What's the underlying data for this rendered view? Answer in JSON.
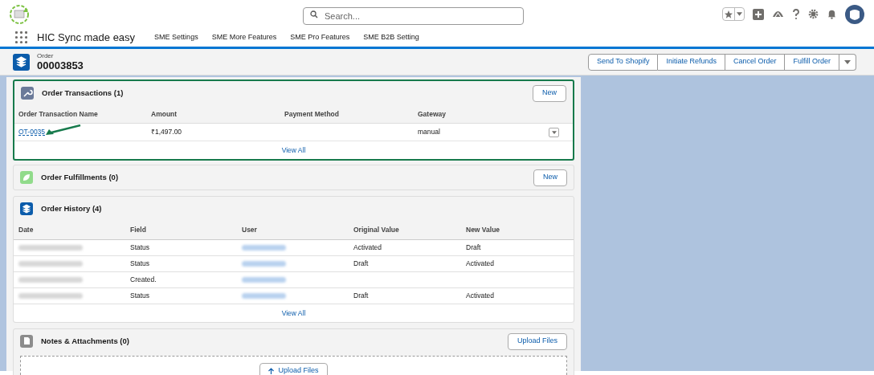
{
  "search": {
    "placeholder": "Search..."
  },
  "app_name": "HIC Sync made easy",
  "nav_items": [
    "SME Settings",
    "SME More Features",
    "SME Pro Features",
    "SME B2B Setting"
  ],
  "record": {
    "type": "Order",
    "number": "00003853"
  },
  "actions": [
    "Send To Shopify",
    "Initiate Refunds",
    "Cancel Order",
    "Fulfill Order"
  ],
  "transactions": {
    "title": "Order Transactions (1)",
    "highlighted": true,
    "button": "New",
    "columns": [
      "Order Transaction Name",
      "Amount",
      "Payment Method",
      "Gateway"
    ],
    "rows": [
      {
        "name": "OT-0035",
        "amount": "₹1,497.00",
        "payment_method": "",
        "gateway": "manual"
      }
    ],
    "view_all": "View All"
  },
  "fulfillments": {
    "title": "Order Fulfillments (0)",
    "button": "New"
  },
  "history": {
    "title": "Order History (4)",
    "columns": [
      "Date",
      "Field",
      "User",
      "Original Value",
      "New Value"
    ],
    "rows": [
      {
        "field": "Status",
        "original": "Activated",
        "new": "Draft"
      },
      {
        "field": "Status",
        "original": "Draft",
        "new": "Activated"
      },
      {
        "field": "Created.",
        "original": "",
        "new": ""
      },
      {
        "field": "Status",
        "original": "Draft",
        "new": "Activated"
      }
    ],
    "view_all": "View All"
  },
  "notes": {
    "title": "Notes & Attachments (0)",
    "button": "Upload Files",
    "drop_button": "Upload Files"
  }
}
